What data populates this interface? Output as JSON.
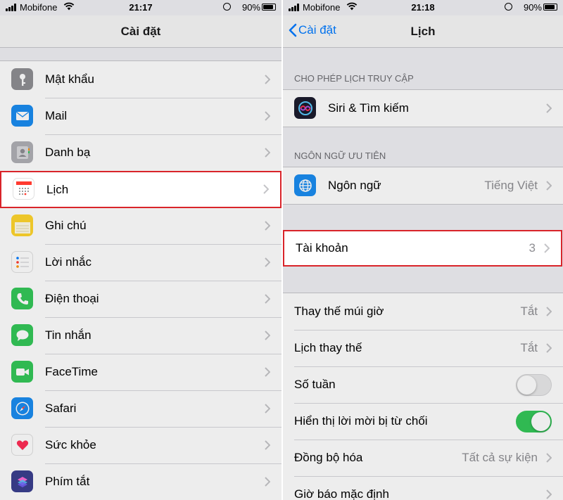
{
  "left": {
    "status": {
      "carrier": "Mobifone",
      "time": "21:17",
      "battery": "90%",
      "battery_fraction": 0.9
    },
    "nav": {
      "title": "Cài đặt"
    },
    "rows": [
      {
        "label": "Mật khẩu",
        "icon": "key-icon",
        "color": "#8e8e93"
      },
      {
        "label": "Mail",
        "icon": "mail-icon",
        "color": "#1a8cf0"
      },
      {
        "label": "Danh bạ",
        "icon": "contacts-icon",
        "color": "#b0b0b5"
      },
      {
        "label": "Lịch",
        "icon": "calendar-icon",
        "color": "#ffffff"
      },
      {
        "label": "Ghi chú",
        "icon": "notes-icon",
        "color": "#ffd52e"
      },
      {
        "label": "Lời nhắc",
        "icon": "reminders-icon",
        "color": "#ffffff"
      },
      {
        "label": "Điện thoại",
        "icon": "phone-icon",
        "color": "#34c759"
      },
      {
        "label": "Tin nhắn",
        "icon": "messages-icon",
        "color": "#34c759"
      },
      {
        "label": "FaceTime",
        "icon": "facetime-icon",
        "color": "#34c759"
      },
      {
        "label": "Safari",
        "icon": "safari-icon",
        "color": "#1a8cf0"
      },
      {
        "label": "Sức khỏe",
        "icon": "health-icon",
        "color": "#ffffff"
      },
      {
        "label": "Phím tắt",
        "icon": "shortcuts-icon",
        "color": "#3b3f8f"
      }
    ]
  },
  "right": {
    "status": {
      "carrier": "Mobifone",
      "time": "21:18",
      "battery": "90%",
      "battery_fraction": 0.9
    },
    "nav": {
      "back_label": "Cài đặt",
      "title": "Lịch"
    },
    "section1_header": "CHO PHÉP LỊCH TRUY CẬP",
    "siri": {
      "label": "Siri & Tìm kiếm",
      "icon": "siri-icon"
    },
    "section2_header": "NGÔN NGỮ ƯU TIÊN",
    "language": {
      "label": "Ngôn ngữ",
      "value": "Tiếng Việt",
      "icon": "globe-icon"
    },
    "accounts": {
      "label": "Tài khoản",
      "value": "3"
    },
    "settings": [
      {
        "label": "Thay thế múi giờ",
        "value": "Tắt",
        "kind": "value"
      },
      {
        "label": "Lịch thay thế",
        "value": "Tắt",
        "kind": "value"
      },
      {
        "label": "Số tuần",
        "kind": "toggle",
        "on": false
      },
      {
        "label": "Hiển thị lời mời bị từ chối",
        "kind": "toggle",
        "on": true
      },
      {
        "label": "Đồng bộ hóa",
        "value": "Tất cả sự kiện",
        "kind": "value"
      },
      {
        "label": "Giờ báo mặc định",
        "kind": "value",
        "value": ""
      }
    ]
  },
  "colors": {
    "highlight": "#d9242a",
    "accent": "#007aff",
    "toggle_on": "#34c759"
  }
}
